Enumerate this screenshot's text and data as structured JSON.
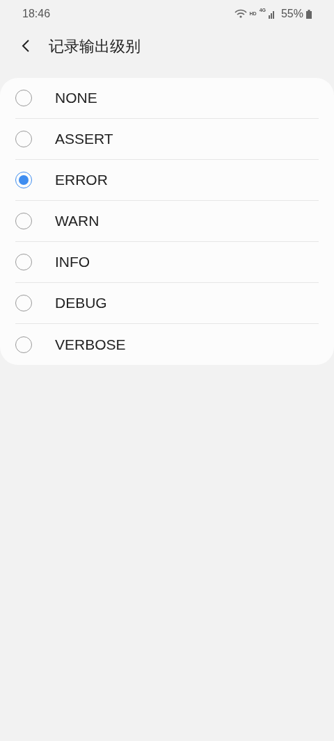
{
  "status_bar": {
    "time": "18:46",
    "network_hd": "HD",
    "network_type": "4G",
    "battery": "55%"
  },
  "header": {
    "title": "记录输出级别"
  },
  "options": [
    {
      "label": "NONE",
      "selected": false
    },
    {
      "label": "ASSERT",
      "selected": false
    },
    {
      "label": "ERROR",
      "selected": true
    },
    {
      "label": "WARN",
      "selected": false
    },
    {
      "label": "INFO",
      "selected": false
    },
    {
      "label": "DEBUG",
      "selected": false
    },
    {
      "label": "VERBOSE",
      "selected": false
    }
  ]
}
